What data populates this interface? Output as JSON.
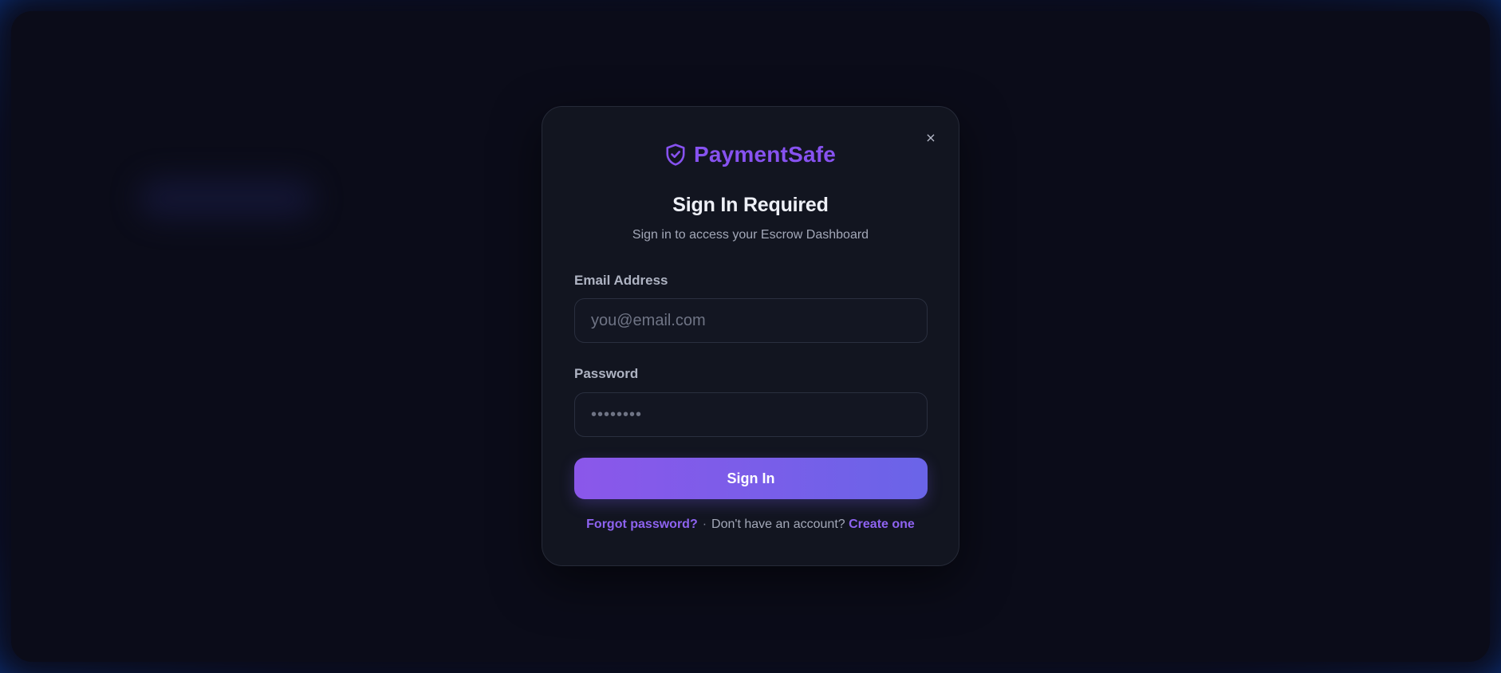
{
  "brand": {
    "name": "PaymentSafe",
    "icon": "shield-check-icon",
    "color": "#8752f0"
  },
  "modal": {
    "close_label": "×",
    "title": "Sign In Required",
    "subtitle": "Sign in to access your Escrow Dashboard"
  },
  "form": {
    "email_label": "Email Address",
    "email_placeholder": "you@email.com",
    "email_value": "",
    "password_label": "Password",
    "password_value": "••••••••",
    "submit_label": "Sign In"
  },
  "footer": {
    "forgot_link": "Forgot password?",
    "separator": "·",
    "no_account_text": "Don't have an account?",
    "create_link": "Create one"
  },
  "colors": {
    "accent": "#8752f0",
    "button_gradient_start": "#8b57ea",
    "button_gradient_end": "#6a64e8",
    "modal_bg": "#121520"
  }
}
